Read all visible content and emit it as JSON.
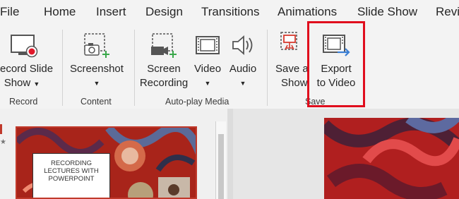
{
  "tabs": [
    "File",
    "Home",
    "Insert",
    "Design",
    "Transitions",
    "Animations",
    "Slide Show",
    "Revi"
  ],
  "ribbon": {
    "record": {
      "line1": "ecord Slide",
      "line2": "Show"
    },
    "screenshot": {
      "line1": "Screenshot"
    },
    "screen_recording": {
      "line1": "Screen",
      "line2": "Recording"
    },
    "video": {
      "line1": "Video"
    },
    "audio": {
      "line1": "Audio"
    },
    "save_as_show": {
      "line1": "Save a",
      "line2": "Show"
    },
    "export_video": {
      "line1": "Export",
      "line2": "to Video"
    },
    "groups": {
      "record": "Record",
      "content": "Content",
      "autoplay": "Auto-play Media",
      "save": "Save"
    }
  },
  "slide_thumb": {
    "title": "RECORDING LECTURES WITH POWERPOINT"
  },
  "colors": {
    "highlight": "#e00d1d",
    "accent_green": "#3aa84a",
    "accent_red": "#d63b2f",
    "accent_blue": "#3b7fd4"
  }
}
